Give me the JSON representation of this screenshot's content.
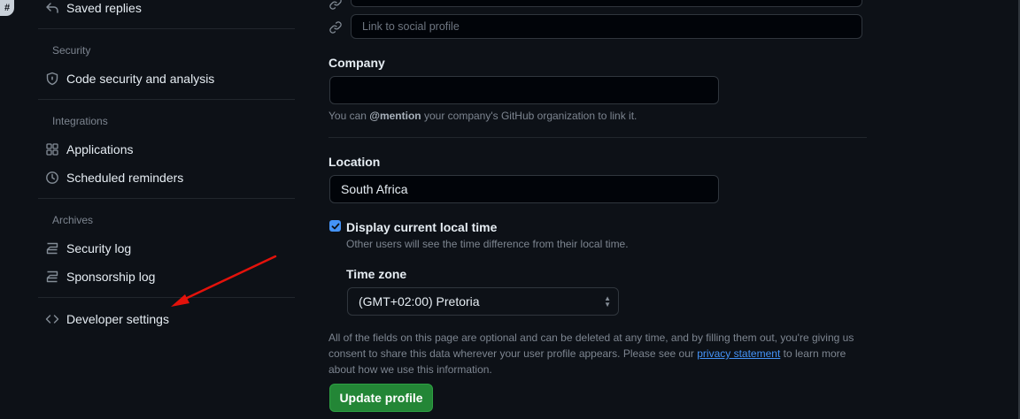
{
  "sidebar": {
    "saved_replies": "Saved replies",
    "security_heading": "Security",
    "code_security": "Code security and analysis",
    "integrations_heading": "Integrations",
    "applications": "Applications",
    "scheduled_reminders": "Scheduled reminders",
    "archives_heading": "Archives",
    "security_log": "Security log",
    "sponsorship_log": "Sponsorship log",
    "developer_settings": "Developer settings"
  },
  "profile": {
    "social_placeholder": "Link to social profile",
    "company_label": "Company",
    "company_value": "",
    "company_note_prefix": "You can ",
    "company_note_mention": "@mention",
    "company_note_suffix": " your company's GitHub organization to link it.",
    "location_label": "Location",
    "location_value": "South Africa",
    "display_time_label": "Display current local time",
    "display_time_checked": true,
    "display_time_note": "Other users will see the time difference from their local time.",
    "timezone_label": "Time zone",
    "timezone_value": "(GMT+02:00) Pretoria",
    "disclaimer_1": "All of the fields on this page are optional and can be deleted at any time, and by filling them out, you're giving us consent to share this data wherever your user profile appears. Please see our ",
    "privacy_link": "privacy statement",
    "disclaimer_2": " to learn more about how we use this information.",
    "update_button": "Update profile"
  },
  "annotation": {
    "arrow_color": "#e3120b"
  }
}
